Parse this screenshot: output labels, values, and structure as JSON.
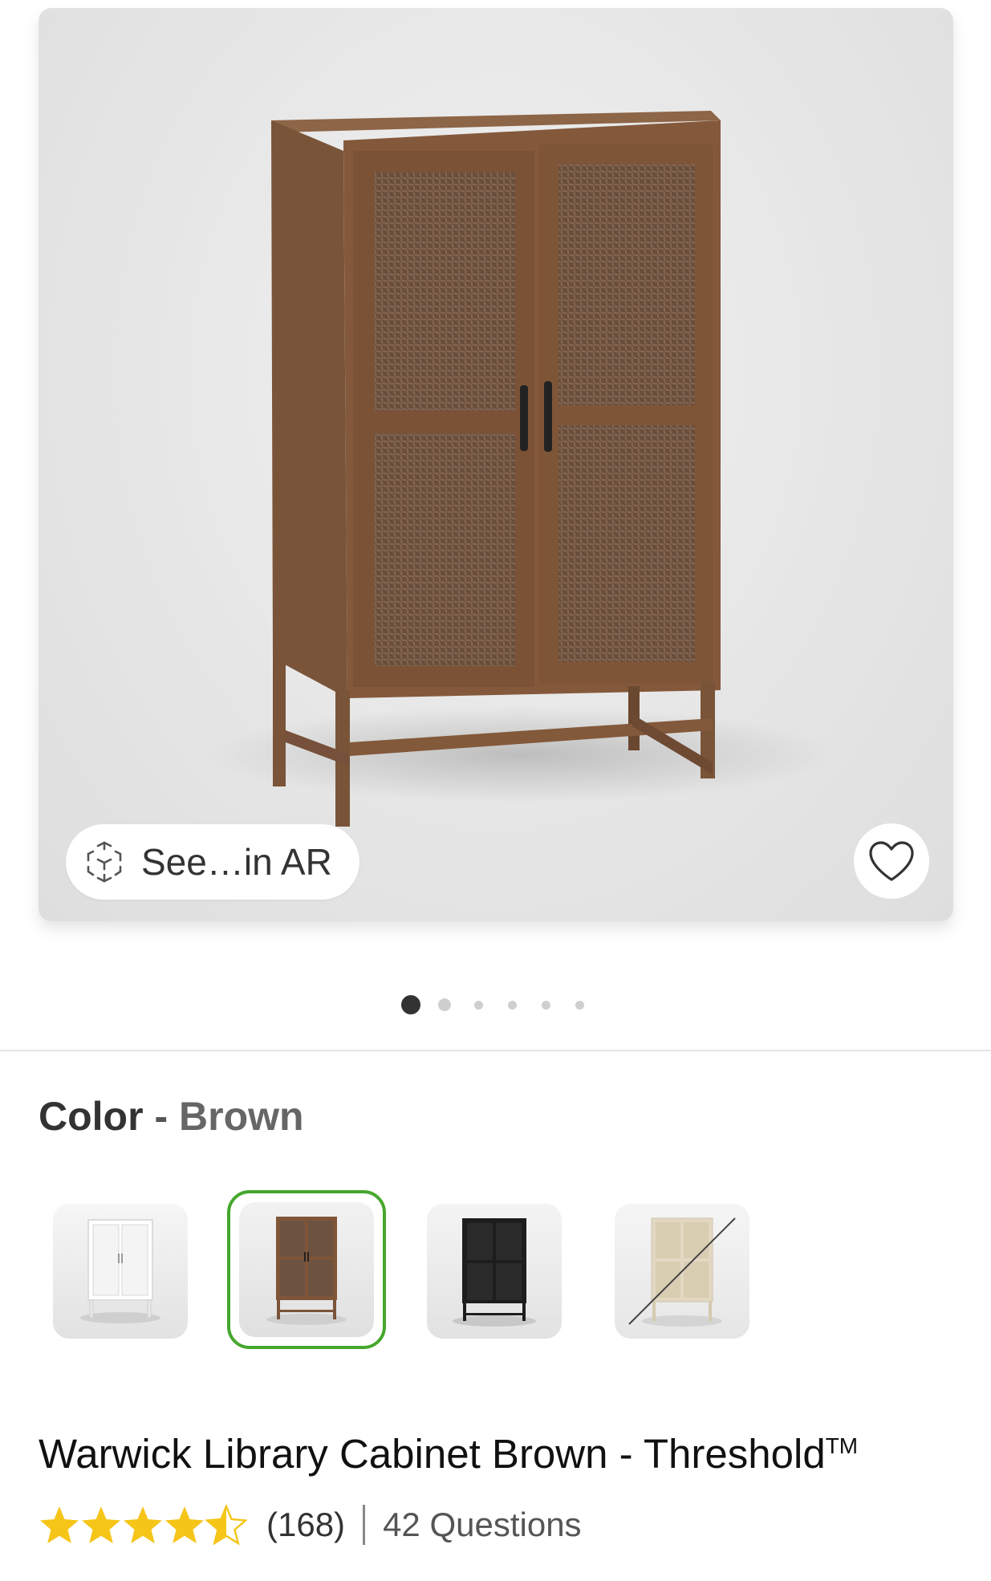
{
  "hero": {
    "ar_button_label": "See…in AR",
    "favorite_icon": "heart-outline-icon",
    "ar_icon": "ar-cube-icon"
  },
  "carousel": {
    "total": 6,
    "active_index": 0
  },
  "color": {
    "label": "Color",
    "separator": "-",
    "selected": "Brown",
    "swatches": [
      {
        "name": "White",
        "tone": "#f2f2f2",
        "available": true,
        "selected": false
      },
      {
        "name": "Brown",
        "tone": "#6b4a32",
        "available": true,
        "selected": true
      },
      {
        "name": "Black",
        "tone": "#1d1d1d",
        "available": true,
        "selected": false
      },
      {
        "name": "Natural",
        "tone": "#e2d8c2",
        "available": false,
        "selected": false
      }
    ],
    "selected_ring_color": "#45a72c"
  },
  "product": {
    "title": "Warwick Library Cabinet Brown - Threshold",
    "trademark": "TM",
    "rating_value": 4.5,
    "rating_count": "(168)",
    "questions": "42 Questions",
    "star_color": "#f5c518"
  }
}
